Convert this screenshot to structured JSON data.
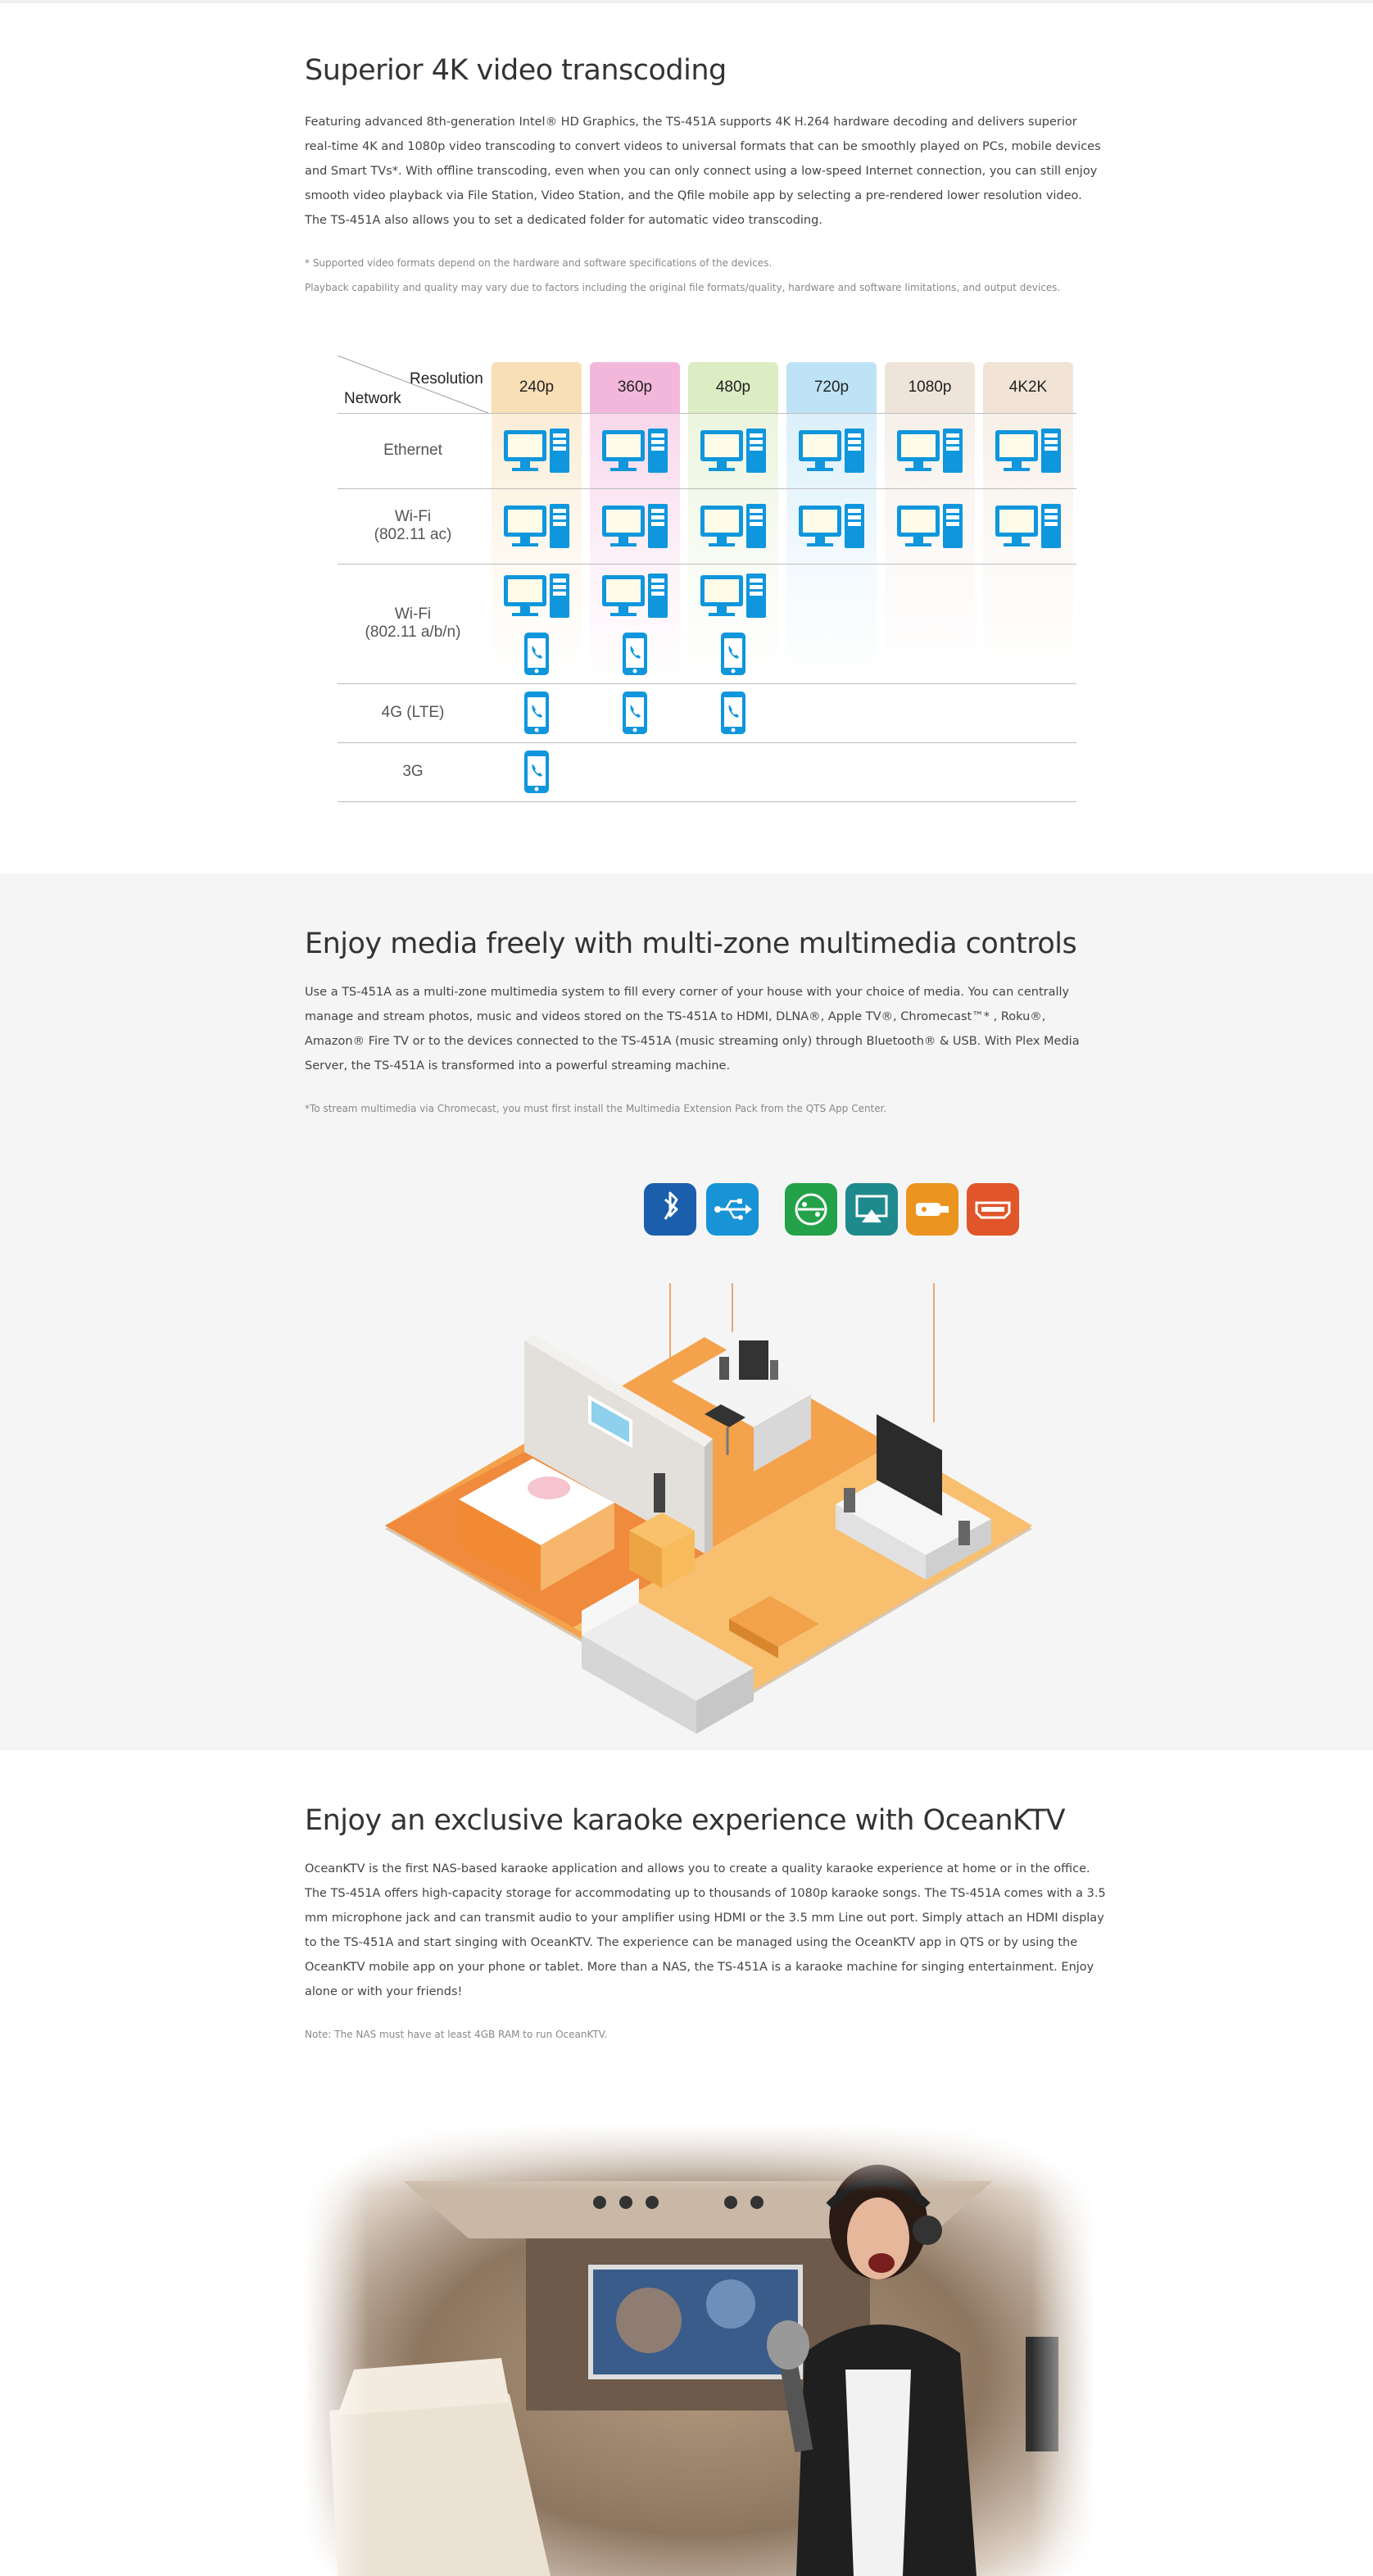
{
  "section_transcoding": {
    "title": "Superior 4K video transcoding",
    "body": "Featuring advanced 8th-generation Intel® HD Graphics, the TS-451A supports 4K H.264 hardware decoding and delivers superior real-time 4K and 1080p video transcoding to convert videos to universal formats that can be smoothly played on PCs, mobile devices and Smart TVs*. With offline transcoding, even when you can only connect using a low-speed Internet connection, you can still enjoy smooth video playback via File Station, Video Station, and the Qfile mobile app by selecting a pre-rendered lower resolution video. The TS-451A also allows you to set a dedicated folder for automatic video transcoding.",
    "note1": "* Supported video formats depend on the hardware and software specifications of the devices.",
    "note2": "Playback capability and quality may vary due to factors including the original file formats/quality, hardware and software limitations, and output devices."
  },
  "transcoding_table": {
    "header_resolution": "Resolution",
    "header_network": "Network",
    "columns": [
      {
        "label": "240p",
        "color": "#f8dfb6"
      },
      {
        "label": "360p",
        "color": "#f4b7dc"
      },
      {
        "label": "480p",
        "color": "#dcecc3"
      },
      {
        "label": "720p",
        "color": "#bfe3f6"
      },
      {
        "label": "1080p",
        "color": "#efe4da"
      },
      {
        "label": "4K2K",
        "color": "#f1e4d6"
      }
    ],
    "rows": [
      {
        "label": "Ethernet",
        "pc": [
          true,
          true,
          true,
          true,
          true,
          true
        ],
        "phone": [
          false,
          false,
          false,
          false,
          false,
          false
        ]
      },
      {
        "label": "Wi-Fi\n(802.11 ac)",
        "pc": [
          true,
          true,
          true,
          true,
          true,
          true
        ],
        "phone": [
          false,
          false,
          false,
          false,
          false,
          false
        ]
      },
      {
        "label": "Wi-Fi\n(802.11 a/b/n)",
        "pc": [
          true,
          true,
          true,
          false,
          false,
          false
        ],
        "phone": [
          true,
          true,
          true,
          false,
          false,
          false
        ]
      },
      {
        "label": "4G (LTE)",
        "pc": [
          false,
          false,
          false,
          false,
          false,
          false
        ],
        "phone": [
          true,
          true,
          true,
          false,
          false,
          false
        ]
      },
      {
        "label": "3G",
        "pc": [
          false,
          false,
          false,
          false,
          false,
          false
        ],
        "phone": [
          true,
          false,
          false,
          false,
          false,
          false
        ]
      }
    ],
    "icon_color": "#0f96dc"
  },
  "section_multizone": {
    "title": "Enjoy media freely with multi-zone multimedia controls",
    "body": "Use a TS-451A as a multi-zone multimedia system to fill every corner of your house with your choice of media. You can centrally manage and stream photos, music and videos stored on the TS-451A to HDMI, DLNA®, Apple TV®, Chromecast™* , Roku®, Amazon® Fire TV or to the devices connected to the TS-451A (music streaming only) through Bluetooth® & USB. With Plex Media Server, the TS-451A is transformed into a powerful streaming machine.",
    "note": "*To stream multimedia via Chromecast, you must first install the Multimedia Extension Pack from the QTS App Center.",
    "icons": [
      {
        "name": "bluetooth-icon",
        "color": "#1b5fac"
      },
      {
        "name": "usb-icon",
        "color": "#1793d6"
      },
      {
        "name": "dlna-icon",
        "color": "#23a24a"
      },
      {
        "name": "airplay-icon",
        "color": "#1f8a8d"
      },
      {
        "name": "media-stick-icon",
        "color": "#ec9420"
      },
      {
        "name": "hdmi-icon",
        "color": "#e0552a"
      }
    ]
  },
  "section_karaoke": {
    "title": "Enjoy an exclusive karaoke experience with OceanKTV",
    "body": "OceanKTV is the first NAS-based karaoke application and allows you to create a quality karaoke experience at home or in the office. The TS-451A offers high-capacity storage for accommodating up to thousands of 1080p karaoke songs. The TS-451A comes with a 3.5 mm microphone jack and can transmit audio to your amplifier using HDMI or the 3.5 mm Line out port. Simply attach an HDMI display to the TS-451A and start singing with OceanKTV. The experience can be managed using the OceanKTV app in QTS or by using the OceanKTV mobile app on your phone or tablet. More than a NAS, the TS-451A is a karaoke machine for singing entertainment. Enjoy alone or with your friends!",
    "note": "Note: The NAS must have at least 4GB RAM to run OceanKTV."
  }
}
